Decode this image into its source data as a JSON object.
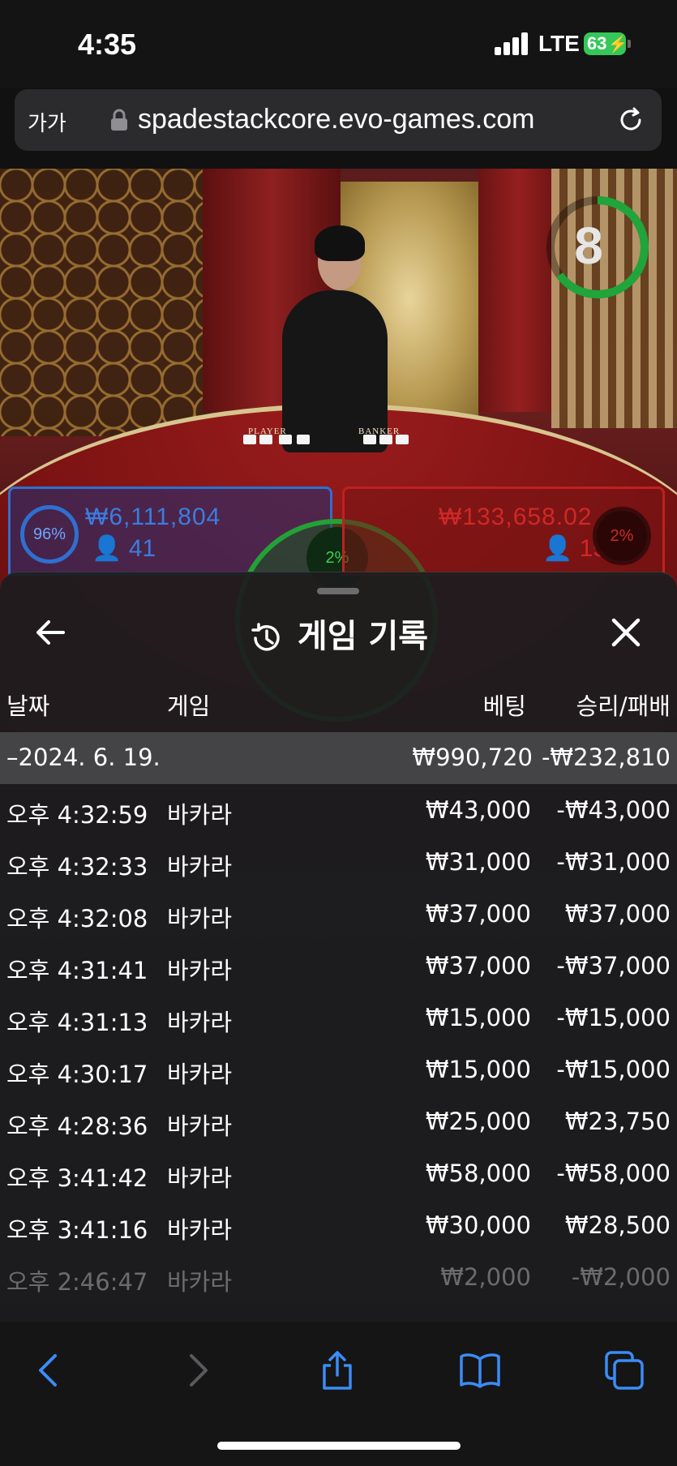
{
  "status_bar": {
    "time": "4:35",
    "network": "LTE",
    "battery": "63"
  },
  "browser": {
    "text_size_label": "가가",
    "url": "spadestackcore.evo-games.com"
  },
  "video": {
    "table_player_label": "PLAYER",
    "table_banker_label": "BANKER",
    "countdown": "8",
    "player": {
      "percent": "96%",
      "amount": "₩6,111,804",
      "count": "41"
    },
    "tie": {
      "percent": "2%"
    },
    "banker": {
      "percent": "2%",
      "amount": "₩133,658.02",
      "count": "15"
    }
  },
  "history": {
    "title": "게임 기록",
    "columns": {
      "date": "날짜",
      "game": "게임",
      "bet": "베팅",
      "result": "승리/패배"
    },
    "summary": {
      "date": "–2024. 6. 19.",
      "bet": "₩990,720",
      "result": "-₩232,810"
    },
    "rows": [
      {
        "time": "오후 4:32:59",
        "game": "바카라",
        "bet": "₩43,000",
        "result": "-₩43,000"
      },
      {
        "time": "오후 4:32:33",
        "game": "바카라",
        "bet": "₩31,000",
        "result": "-₩31,000"
      },
      {
        "time": "오후 4:32:08",
        "game": "바카라",
        "bet": "₩37,000",
        "result": "₩37,000"
      },
      {
        "time": "오후 4:31:41",
        "game": "바카라",
        "bet": "₩37,000",
        "result": "-₩37,000"
      },
      {
        "time": "오후 4:31:13",
        "game": "바카라",
        "bet": "₩15,000",
        "result": "-₩15,000"
      },
      {
        "time": "오후 4:30:17",
        "game": "바카라",
        "bet": "₩15,000",
        "result": "-₩15,000"
      },
      {
        "time": "오후 4:28:36",
        "game": "바카라",
        "bet": "₩25,000",
        "result": "₩23,750"
      },
      {
        "time": "오후 3:41:42",
        "game": "바카라",
        "bet": "₩58,000",
        "result": "-₩58,000"
      },
      {
        "time": "오후 3:41:16",
        "game": "바카라",
        "bet": "₩30,000",
        "result": "₩28,500"
      },
      {
        "time": "오후 2:46:47",
        "game": "바카라",
        "bet": "₩2,000",
        "result": "-₩2,000"
      }
    ]
  },
  "colors": {
    "player_blue": "#2f6fd0",
    "banker_red": "#c02020",
    "tie_green": "#23a136",
    "ios_blue": "#3b8cf6"
  },
  "icons": [
    "back-arrow-icon",
    "history-icon",
    "close-icon",
    "chevron-left-icon",
    "chevron-right-icon",
    "share-icon",
    "bookmarks-icon",
    "tabs-icon",
    "lock-icon",
    "reload-icon"
  ]
}
